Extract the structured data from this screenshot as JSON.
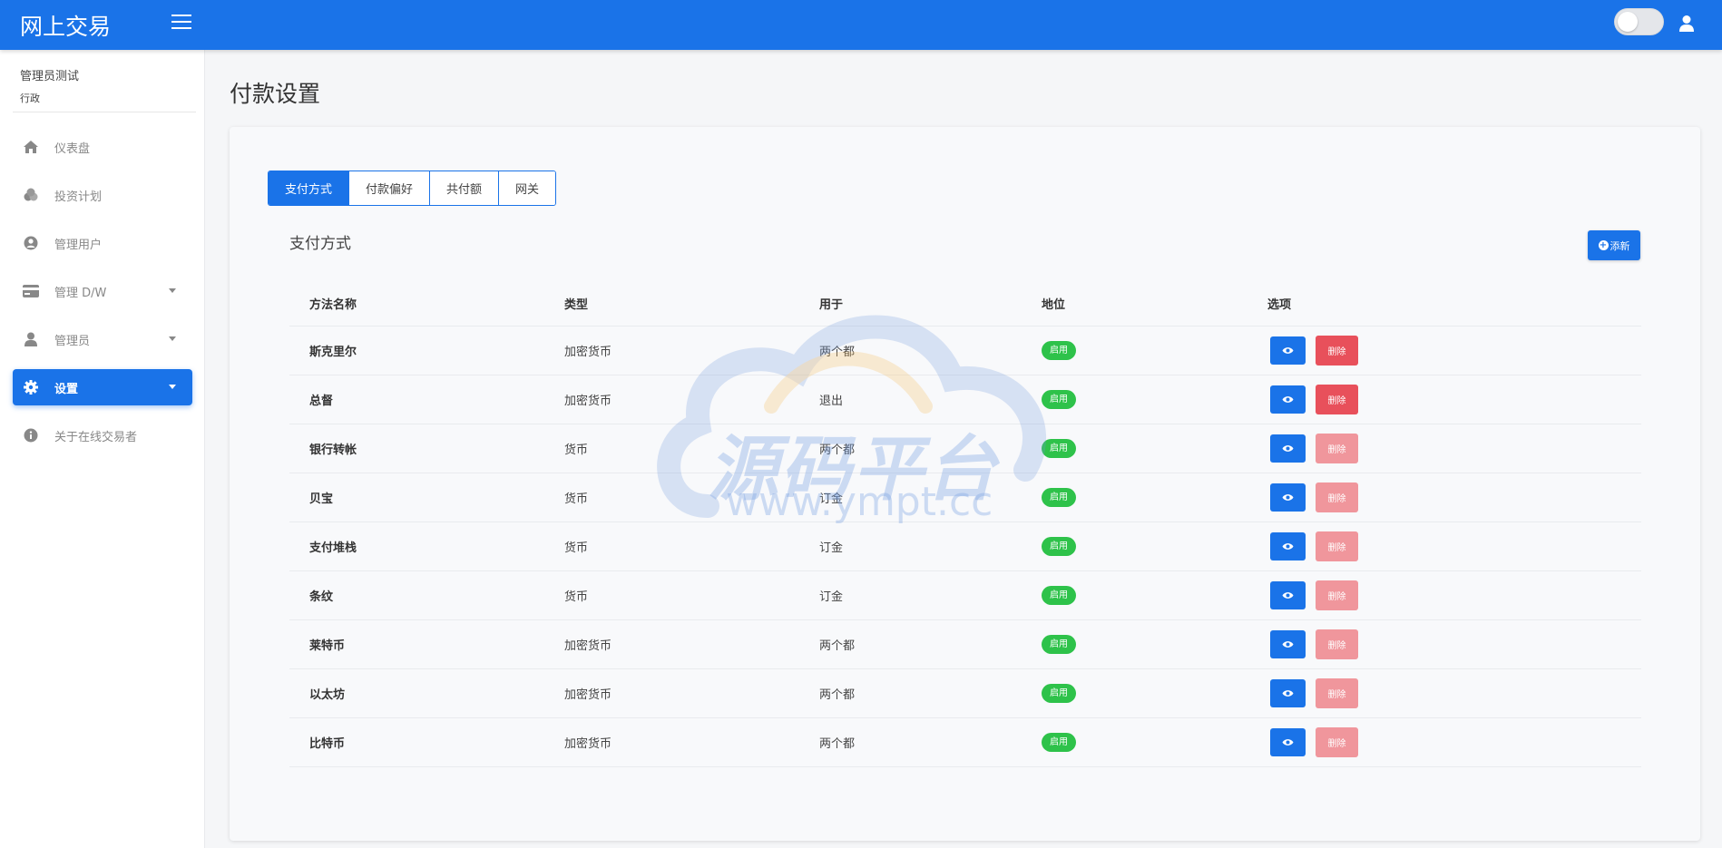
{
  "app": {
    "brand": "网上交易"
  },
  "sidebar": {
    "profile_name": "管理员测试",
    "profile_role": "行政",
    "items": [
      {
        "label": "仪表盘",
        "icon": "home-icon"
      },
      {
        "label": "投资计划",
        "icon": "coins-icon"
      },
      {
        "label": "管理用户",
        "icon": "user-circle-icon"
      },
      {
        "label": "管理 D/W",
        "icon": "credit-card-icon"
      },
      {
        "label": "管理员",
        "icon": "user-icon"
      },
      {
        "label": "设置",
        "icon": "gear-icon"
      },
      {
        "label": "关于在线交易者",
        "icon": "info-icon"
      }
    ]
  },
  "page": {
    "title": "付款设置"
  },
  "tabs": [
    "支付方式",
    "付款偏好",
    "共付额",
    "网关"
  ],
  "section": {
    "title": "支付方式",
    "add_label": "添新"
  },
  "table": {
    "headers": [
      "方法名称",
      "类型",
      "用于",
      "地位",
      "选项"
    ],
    "rows": [
      {
        "name": "斯克里尔",
        "type": "加密货币",
        "usage": "两个都",
        "status": "启用",
        "delete": "删除"
      },
      {
        "name": "总督",
        "type": "加密货币",
        "usage": "退出",
        "status": "启用",
        "delete": "删除"
      },
      {
        "name": "银行转帐",
        "type": "货币",
        "usage": "两个都",
        "status": "启用",
        "delete": "删除"
      },
      {
        "name": "贝宝",
        "type": "货币",
        "usage": "订金",
        "status": "启用",
        "delete": "删除"
      },
      {
        "name": "支付堆栈",
        "type": "货币",
        "usage": "订金",
        "status": "启用",
        "delete": "删除"
      },
      {
        "name": "条纹",
        "type": "货币",
        "usage": "订金",
        "status": "启用",
        "delete": "删除"
      },
      {
        "name": "莱特币",
        "type": "加密货币",
        "usage": "两个都",
        "status": "启用",
        "delete": "删除"
      },
      {
        "name": "以太坊",
        "type": "加密货币",
        "usage": "两个都",
        "status": "启用",
        "delete": "删除"
      },
      {
        "name": "比特币",
        "type": "加密货币",
        "usage": "两个都",
        "status": "启用",
        "delete": "删除"
      }
    ]
  },
  "watermark": {
    "text": "源码平台",
    "url": "www.ympt.cc"
  },
  "colors": {
    "primary": "#1a73e8",
    "success": "#2ec24a",
    "danger": "#e8505b"
  }
}
